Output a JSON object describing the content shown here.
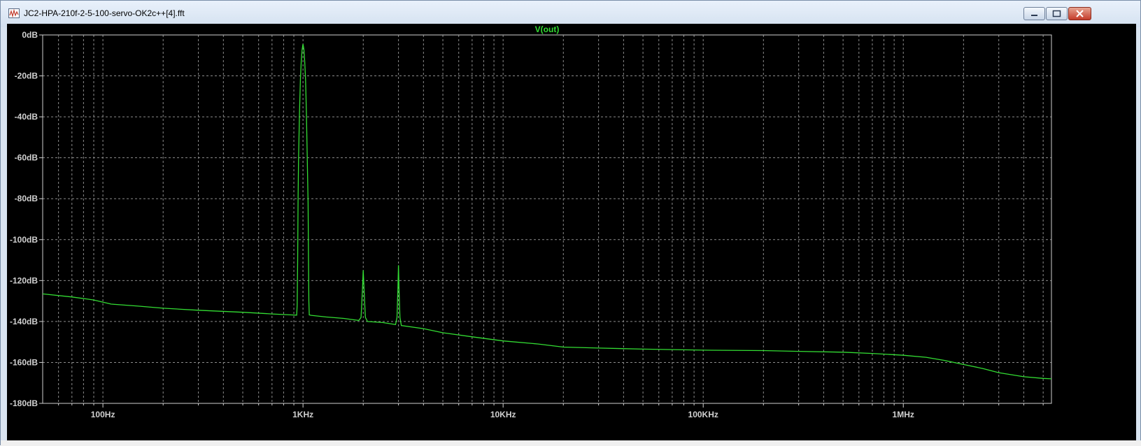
{
  "window": {
    "title": "JC2-HPA-210f-2-5-100-servo-OK2c++[4].fft",
    "controls": [
      "minimize",
      "maximize",
      "close"
    ]
  },
  "icons": {
    "app": "waveform-app-icon",
    "minimize": "minimize-icon",
    "maximize": "maximize-icon",
    "close": "close-icon"
  },
  "colors": {
    "background": "#000000",
    "trace": "#33dd33",
    "grid": "#8c8c8c",
    "axis_text": "#d0d0d0"
  },
  "chart_data": {
    "type": "line",
    "title": "V(out)",
    "xlabel": "",
    "ylabel": "",
    "x_scale": "log",
    "xlim": [
      50,
      5500000
    ],
    "ylim": [
      -180,
      0
    ],
    "grid": true,
    "x_ticks": [
      {
        "value": 100,
        "label": "100Hz"
      },
      {
        "value": 1000,
        "label": "1KHz"
      },
      {
        "value": 10000,
        "label": "10KHz"
      },
      {
        "value": 100000,
        "label": "100KHz"
      },
      {
        "value": 1000000,
        "label": "1MHz"
      }
    ],
    "y_ticks": [
      {
        "value": 0,
        "label": "0dB"
      },
      {
        "value": -20,
        "label": "-20dB"
      },
      {
        "value": -40,
        "label": "-40dB"
      },
      {
        "value": -60,
        "label": "-60dB"
      },
      {
        "value": -80,
        "label": "-80dB"
      },
      {
        "value": -100,
        "label": "-100dB"
      },
      {
        "value": -120,
        "label": "-120dB"
      },
      {
        "value": -140,
        "label": "-140dB"
      },
      {
        "value": -160,
        "label": "-160dB"
      },
      {
        "value": -180,
        "label": "-180dB"
      }
    ],
    "series": [
      {
        "name": "V(out)",
        "points": [
          [
            50,
            -126.5
          ],
          [
            70,
            -128
          ],
          [
            90,
            -129.5
          ],
          [
            110,
            -131.5
          ],
          [
            150,
            -132.5
          ],
          [
            200,
            -133.5
          ],
          [
            300,
            -134.5
          ],
          [
            500,
            -135.5
          ],
          [
            700,
            -136.3
          ],
          [
            880,
            -136.8
          ],
          [
            930,
            -136.9
          ],
          [
            935,
            -132
          ],
          [
            940,
            -110
          ],
          [
            945,
            -80
          ],
          [
            950,
            -60
          ],
          [
            960,
            -38
          ],
          [
            970,
            -22
          ],
          [
            980,
            -13
          ],
          [
            990,
            -7
          ],
          [
            1000,
            -4.5
          ],
          [
            1010,
            -7
          ],
          [
            1020,
            -13
          ],
          [
            1030,
            -22
          ],
          [
            1040,
            -38
          ],
          [
            1050,
            -60
          ],
          [
            1060,
            -82
          ],
          [
            1065,
            -110
          ],
          [
            1070,
            -130
          ],
          [
            1075,
            -136.8
          ],
          [
            1100,
            -137
          ],
          [
            1300,
            -137.8
          ],
          [
            1600,
            -138.5
          ],
          [
            1900,
            -139.5
          ],
          [
            1950,
            -138
          ],
          [
            1980,
            -125
          ],
          [
            2000,
            -115
          ],
          [
            2020,
            -125
          ],
          [
            2050,
            -138
          ],
          [
            2100,
            -140
          ],
          [
            2500,
            -140.5
          ],
          [
            2900,
            -141.5
          ],
          [
            2950,
            -138
          ],
          [
            2980,
            -124
          ],
          [
            3000,
            -112.5
          ],
          [
            3020,
            -124
          ],
          [
            3050,
            -138
          ],
          [
            3100,
            -142
          ],
          [
            4000,
            -143.5
          ],
          [
            5000,
            -145.5
          ],
          [
            7000,
            -147.5
          ],
          [
            10000,
            -149.5
          ],
          [
            15000,
            -151
          ],
          [
            20000,
            -152.5
          ],
          [
            30000,
            -153
          ],
          [
            50000,
            -153.5
          ],
          [
            100000,
            -154
          ],
          [
            200000,
            -154.2
          ],
          [
            300000,
            -154.6
          ],
          [
            500000,
            -155
          ],
          [
            700000,
            -155.6
          ],
          [
            1000000,
            -156.5
          ],
          [
            1300000,
            -157.5
          ],
          [
            1600000,
            -159
          ],
          [
            2000000,
            -161
          ],
          [
            2500000,
            -163
          ],
          [
            3000000,
            -165
          ],
          [
            4000000,
            -167
          ],
          [
            5000000,
            -167.8
          ],
          [
            5500000,
            -168
          ]
        ]
      }
    ]
  }
}
